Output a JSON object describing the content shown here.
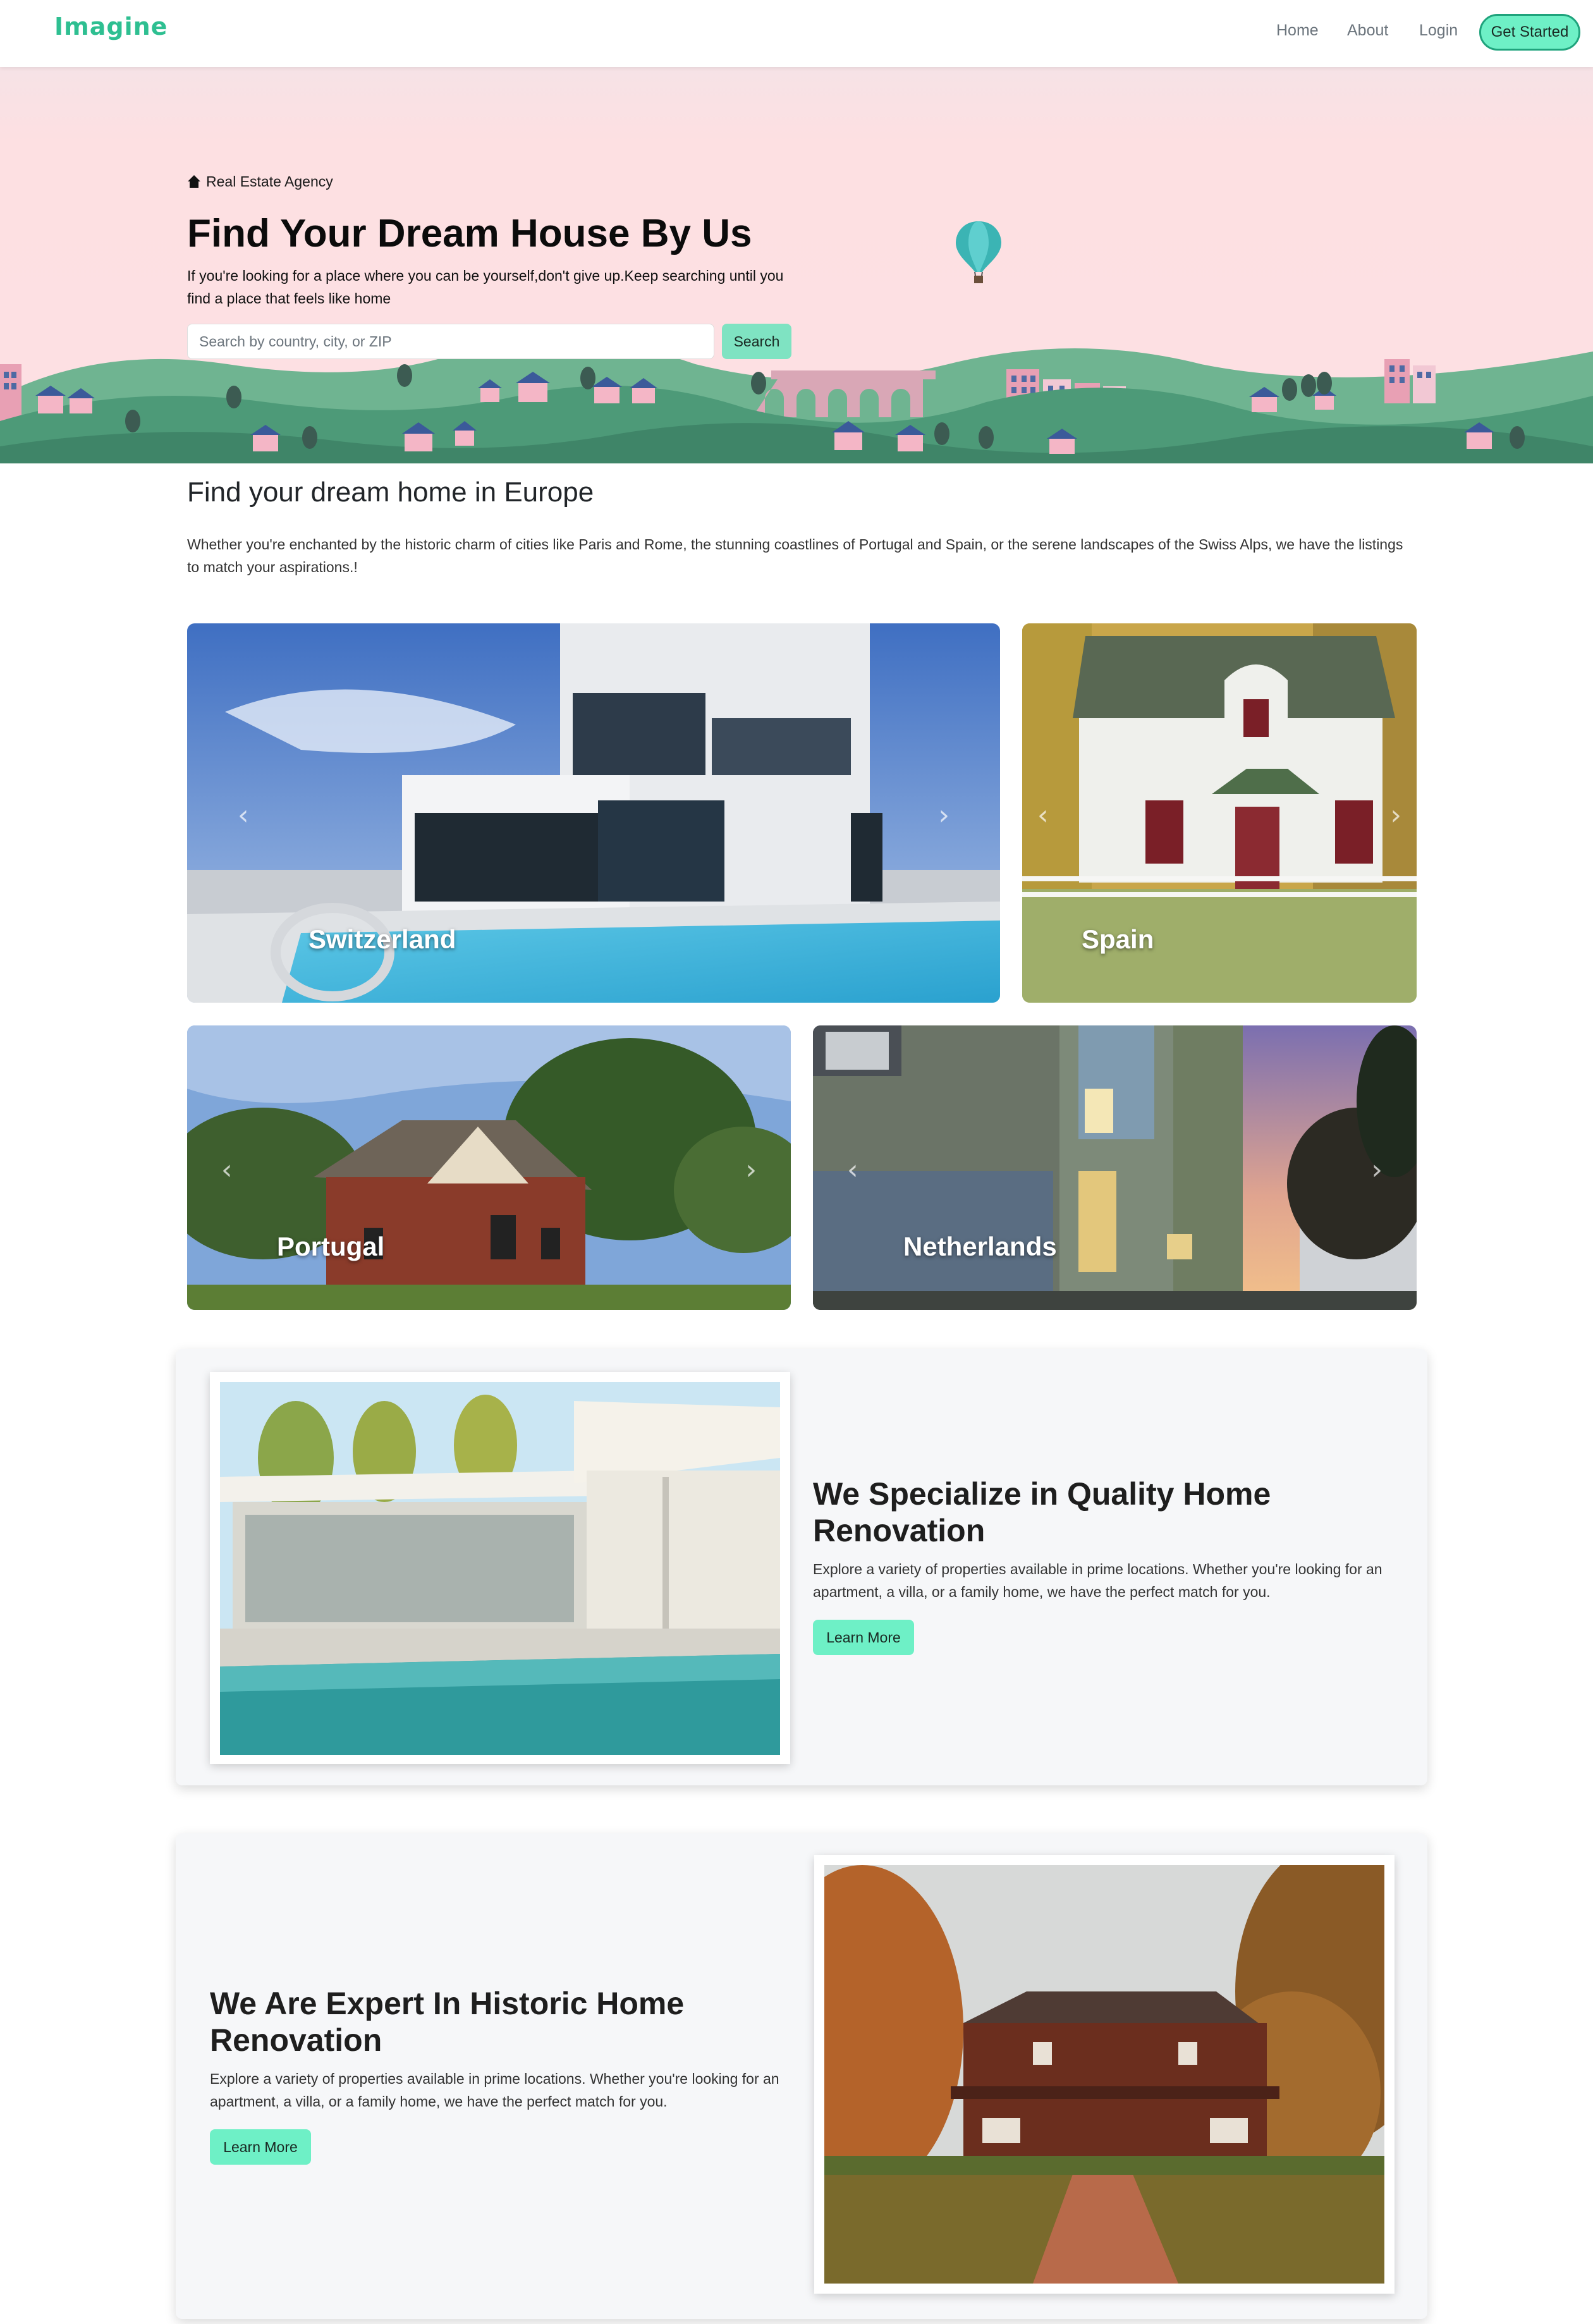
{
  "nav": {
    "brand": "Imagine",
    "links": [
      "Home",
      "About",
      "Login"
    ],
    "cta": "Get Started"
  },
  "hero": {
    "tag": "Real Estate Agency",
    "title": "Find Your Dream House By Us",
    "description": "If you're looking for a place where you can be yourself,don't give up.Keep searching until you find a place that feels like home",
    "search_placeholder": "Search by country, city, or ZIP",
    "search_button": "Search"
  },
  "europe": {
    "title": "Find your dream home in Europe",
    "description": "Whether you're enchanted by the historic charm of cities like Paris and Rome, the stunning coastlines of Portugal and Spain, or the serene landscapes of the Swiss Alps, we have the listings to match your aspirations.!",
    "cards": [
      "Switzerland",
      "Spain",
      "Portugal",
      "Netherlands"
    ]
  },
  "features": [
    {
      "title": "We Specialize in Quality Home Renovation",
      "text": "Explore a variety of properties available in prime locations. Whether you're looking for an apartment, a villa, or a family home, we have the perfect match for you.",
      "button": "Learn More"
    },
    {
      "title": "We Are Expert In Historic Home Renovation",
      "text": "Explore a variety of properties available in prime locations. Whether you're looking for an apartment, a villa, or a family home, we have the perfect match for you.",
      "button": "Learn More"
    }
  ],
  "colors": {
    "brand": "#2ebf91",
    "accent": "#6ef0c6",
    "hero_bg": "#fde0e3"
  }
}
